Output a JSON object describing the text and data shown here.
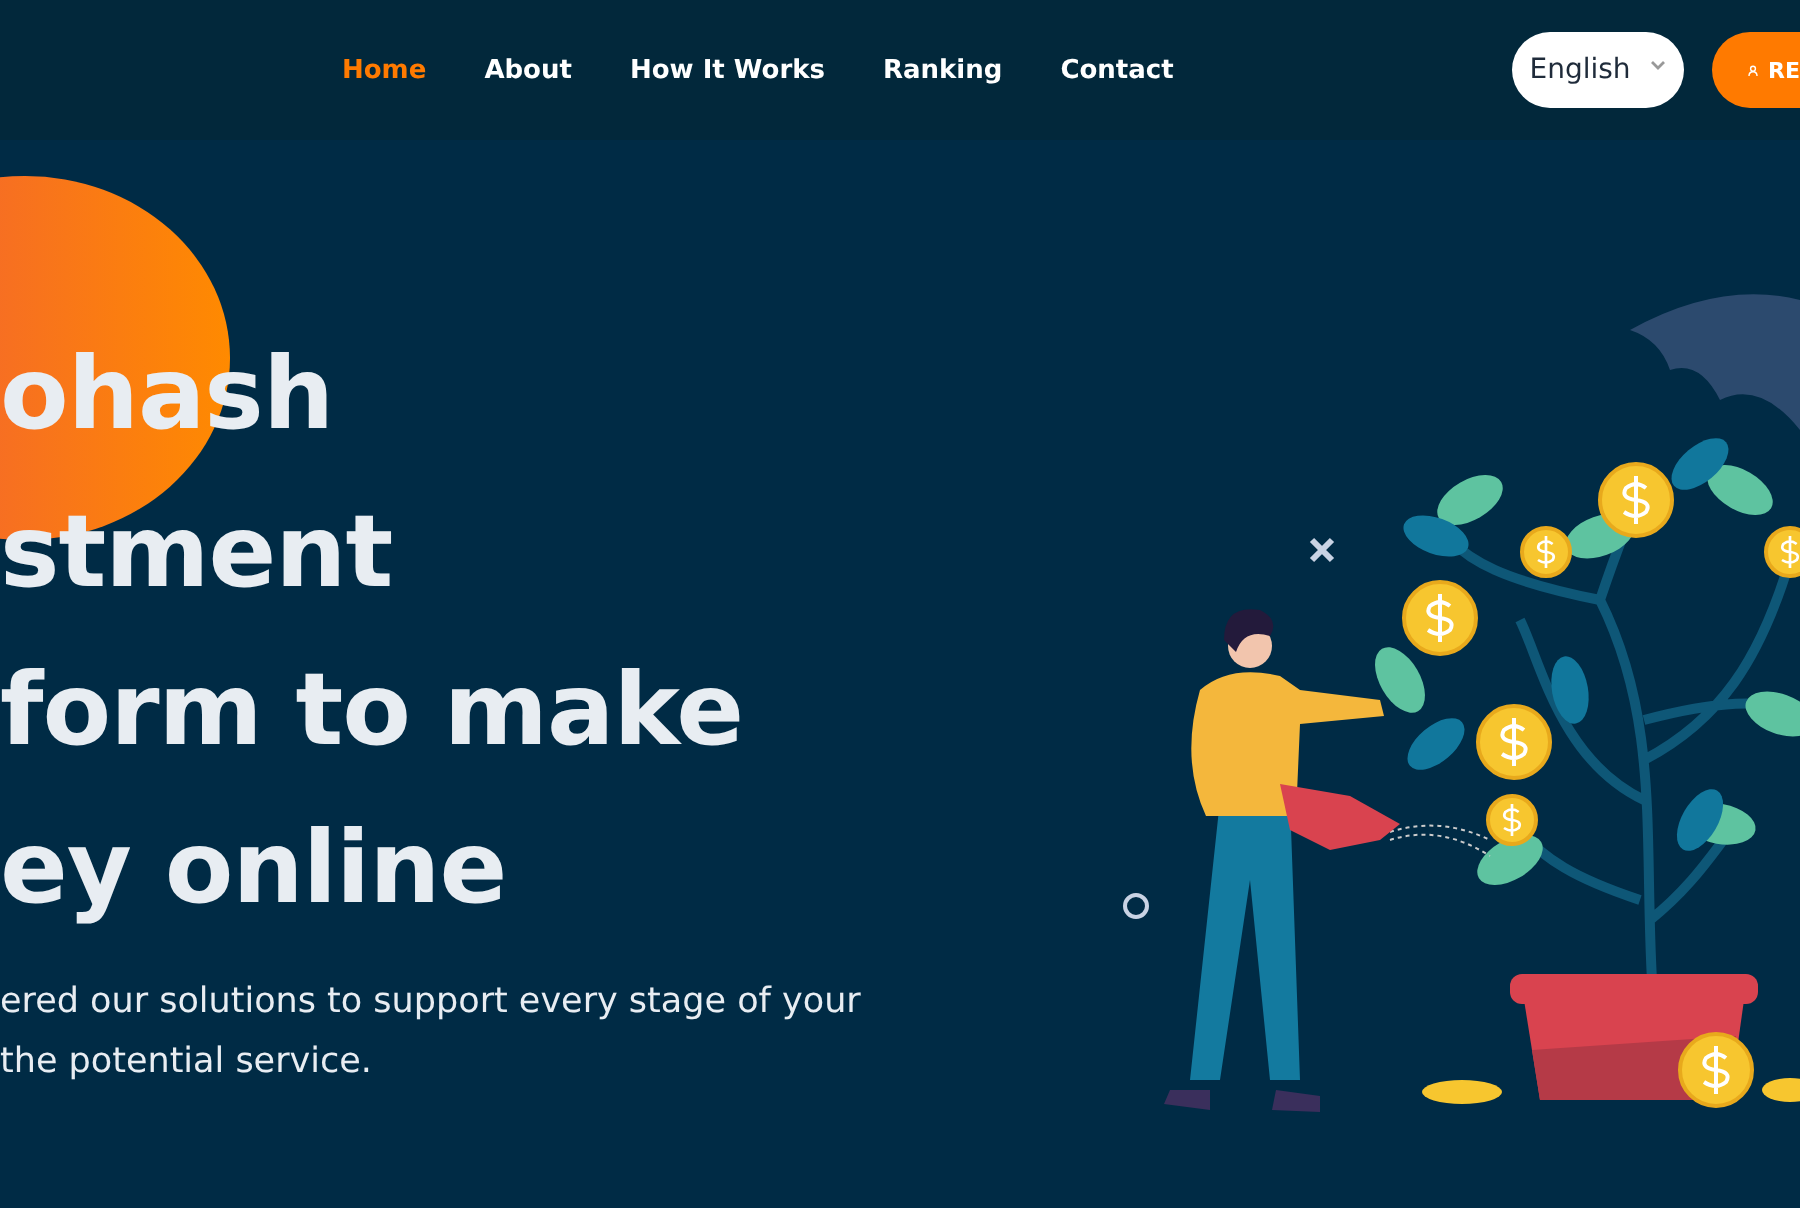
{
  "nav": {
    "items": [
      {
        "label": "Home",
        "selected": true
      },
      {
        "label": "About",
        "selected": false
      },
      {
        "label": "How It Works",
        "selected": false
      },
      {
        "label": "Ranking",
        "selected": false
      },
      {
        "label": "Contact",
        "selected": false
      }
    ],
    "language": "English",
    "register_button": "RE"
  },
  "hero": {
    "title_lines": [
      "ohash",
      "stment",
      "form to make",
      "ey online"
    ],
    "subtitle_lines": [
      "ered our solutions to support every stage of your",
      "the potential service."
    ]
  }
}
